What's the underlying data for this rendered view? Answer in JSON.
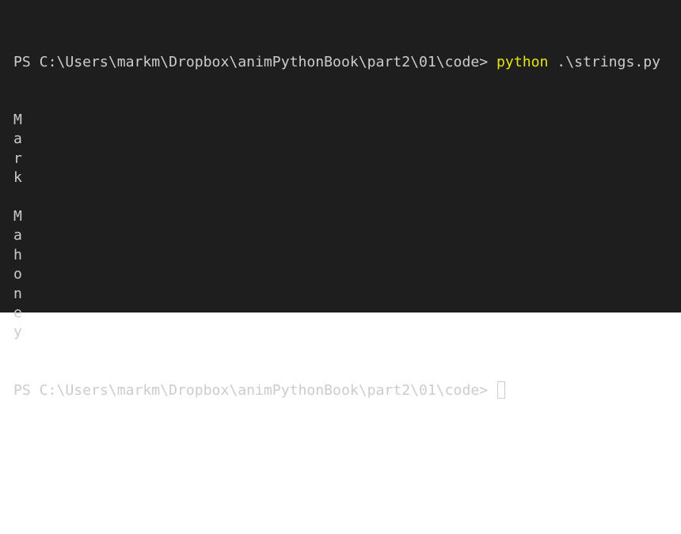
{
  "terminal": {
    "prompt": "PS C:\\Users\\markm\\Dropbox\\animPythonBook\\part2\\01\\code> ",
    "command": "python",
    "args": " .\\strings.py",
    "output": [
      "M",
      "a",
      "r",
      "k",
      " ",
      "M",
      "a",
      "h",
      "o",
      "n",
      "e",
      "y"
    ],
    "colors": {
      "background": "#1e1e1e",
      "text": "#cccccc",
      "command": "#e5e510"
    }
  }
}
